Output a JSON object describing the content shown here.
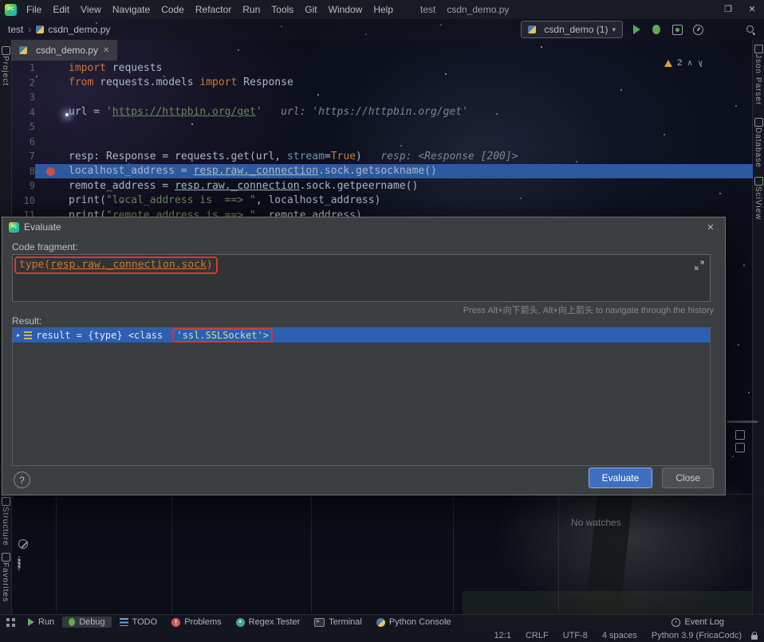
{
  "titlebar": {
    "logo": "PC",
    "menu": [
      "File",
      "Edit",
      "View",
      "Navigate",
      "Code",
      "Refactor",
      "Run",
      "Tools",
      "Git",
      "Window",
      "Help"
    ],
    "title_project": "test",
    "title_file": "csdn_demo.py"
  },
  "icons": {
    "restore": "❐",
    "close": "✕",
    "caret_down": "▾",
    "breadcrumb_sep": "›",
    "help": "?",
    "chev_up": "∧",
    "chev_down": "∨",
    "result_chevron": "▶"
  },
  "navbar": {
    "breadcrumb": [
      "test",
      "csdn_demo.py"
    ],
    "run_config": "csdn_demo (1)"
  },
  "editor_tab": {
    "label": "csdn_demo.py"
  },
  "left_strip": {
    "top": "Project",
    "bottom": [
      "Structure",
      "Favorites"
    ]
  },
  "right_strip": [
    "Json Parser",
    "Database",
    "SciView"
  ],
  "editor": {
    "warning_count": "2",
    "lines": [
      {
        "n": "1",
        "segs": [
          [
            "kw",
            "import"
          ],
          [
            "pl",
            " requests"
          ]
        ]
      },
      {
        "n": "2",
        "segs": [
          [
            "kw",
            "from"
          ],
          [
            "pl",
            " requests.models "
          ],
          [
            "kw",
            "import"
          ],
          [
            "pl",
            " Response"
          ]
        ]
      },
      {
        "n": "3",
        "segs": []
      },
      {
        "n": "4",
        "segs": [
          [
            "pl",
            "url = "
          ],
          [
            "str",
            "'"
          ],
          [
            "lnk",
            "https://httpbin.org/get"
          ],
          [
            "str",
            "'"
          ],
          [
            "hint",
            "   url: 'https://httpbin.org/get'"
          ]
        ]
      },
      {
        "n": "5",
        "segs": []
      },
      {
        "n": "6",
        "segs": []
      },
      {
        "n": "7",
        "segs": [
          [
            "pl",
            "resp: Response = requests.get(url, "
          ],
          [
            "par",
            "stream"
          ],
          [
            "pl",
            "="
          ],
          [
            "kw",
            "True"
          ],
          [
            "pl",
            ")"
          ],
          [
            "hint",
            "   resp: <Response [200]>"
          ]
        ]
      },
      {
        "n": "8",
        "segs": [
          [
            "pl",
            "localhost_address = "
          ],
          [
            "ul",
            "resp.raw._connection"
          ],
          [
            "pl",
            ".sock.getsockname()"
          ]
        ]
      },
      {
        "n": "9",
        "segs": [
          [
            "pl",
            "remote_address = "
          ],
          [
            "ul",
            "resp.raw._connection"
          ],
          [
            "pl",
            ".sock.getpeername()"
          ]
        ]
      },
      {
        "n": "10",
        "segs": [
          [
            "pl",
            "print("
          ],
          [
            "str",
            "\"local_address is  ==> \""
          ],
          [
            "pl",
            ", localhost_address)"
          ]
        ]
      },
      {
        "n": "11",
        "segs": [
          [
            "pl",
            "print("
          ],
          [
            "str",
            "\"remote_address is ==> \""
          ],
          [
            "pl",
            ", remote_address)"
          ]
        ]
      }
    ]
  },
  "dialog": {
    "title": "Evaluate",
    "code_fragment_label": "Code fragment:",
    "expr_pre": "type(",
    "expr_mid": "resp.raw._connection.sock",
    "expr_post": ")",
    "history_hint": "Press Alt+向下箭头, Alt+向上箭头 to navigate through the history",
    "result_label": "Result:",
    "result_prefix": "result = {type} <class ",
    "result_value": "'ssl.SSLSocket'>",
    "evaluate_button": "Evaluate",
    "close_button": "Close"
  },
  "debug_panel": {
    "no_watches": "No watches"
  },
  "bottom_bar": {
    "items": [
      "Run",
      "Debug",
      "TODO",
      "Problems",
      "Regex Tester",
      "Terminal",
      "Python Console"
    ],
    "event_log": "Event Log"
  },
  "statusbar": {
    "caret": "12:1",
    "line_ending": "CRLF",
    "encoding": "UTF-8",
    "indent": "4 spaces",
    "interpreter": "Python 3.9 (FricaCodc)"
  }
}
